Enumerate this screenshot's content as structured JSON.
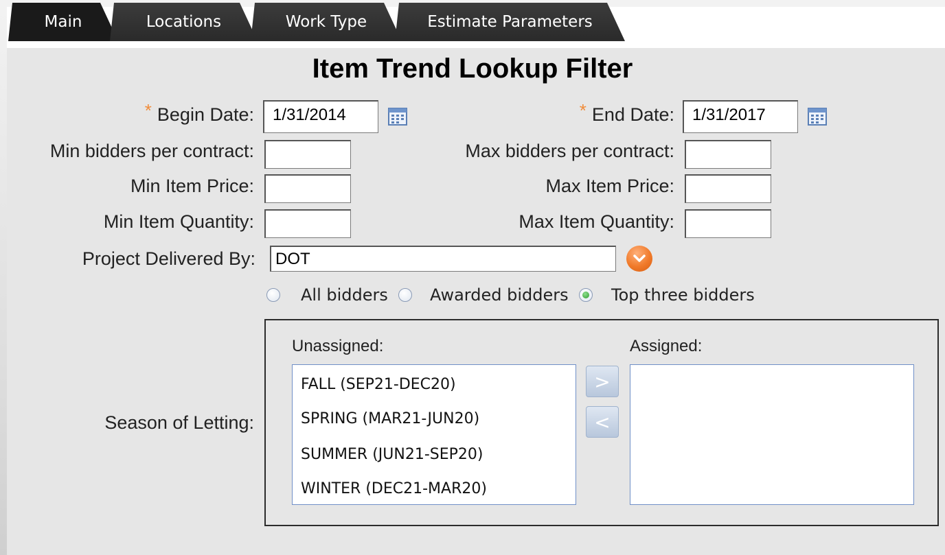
{
  "tabs": [
    {
      "label": "Main",
      "active": true
    },
    {
      "label": "Locations",
      "active": false
    },
    {
      "label": "Work Type",
      "active": false
    },
    {
      "label": "Estimate Parameters",
      "active": false
    }
  ],
  "title": "Item Trend Lookup Filter",
  "required_marker": "*",
  "begin_date": {
    "label": "Begin Date:",
    "value": "1/31/2014"
  },
  "end_date": {
    "label": "End Date:",
    "value": "1/31/2017"
  },
  "min_bidders": {
    "label": "Min bidders per contract:",
    "value": ""
  },
  "max_bidders": {
    "label": "Max bidders per contract:",
    "value": ""
  },
  "min_price": {
    "label": "Min Item Price:",
    "value": ""
  },
  "max_price": {
    "label": "Max Item Price:",
    "value": ""
  },
  "min_qty": {
    "label": "Min Item Quantity:",
    "value": ""
  },
  "max_qty": {
    "label": "Max Item Quantity:",
    "value": ""
  },
  "delivered_by": {
    "label": "Project Delivered By:",
    "value": "DOT"
  },
  "bidder_options": [
    {
      "label": "All bidders",
      "selected": false
    },
    {
      "label": "Awarded bidders",
      "selected": false
    },
    {
      "label": "Top three bidders",
      "selected": true
    }
  ],
  "season": {
    "label": "Season of Letting:",
    "unassigned_label": "Unassigned:",
    "assigned_label": "Assigned:",
    "unassigned": [
      "FALL (SEP21-DEC20)",
      "SPRING (MAR21-JUN20)",
      "SUMMER (JUN21-SEP20)",
      "WINTER (DEC21-MAR20)"
    ],
    "assigned": [],
    "move_right": ">",
    "move_left": "<"
  },
  "colors": {
    "accent": "#f07a2a",
    "tab_bg": "#2a2a2a",
    "required": "#f08c3a"
  },
  "icons": {
    "calendar": "calendar-icon",
    "dropdown": "chevron-down-icon"
  }
}
